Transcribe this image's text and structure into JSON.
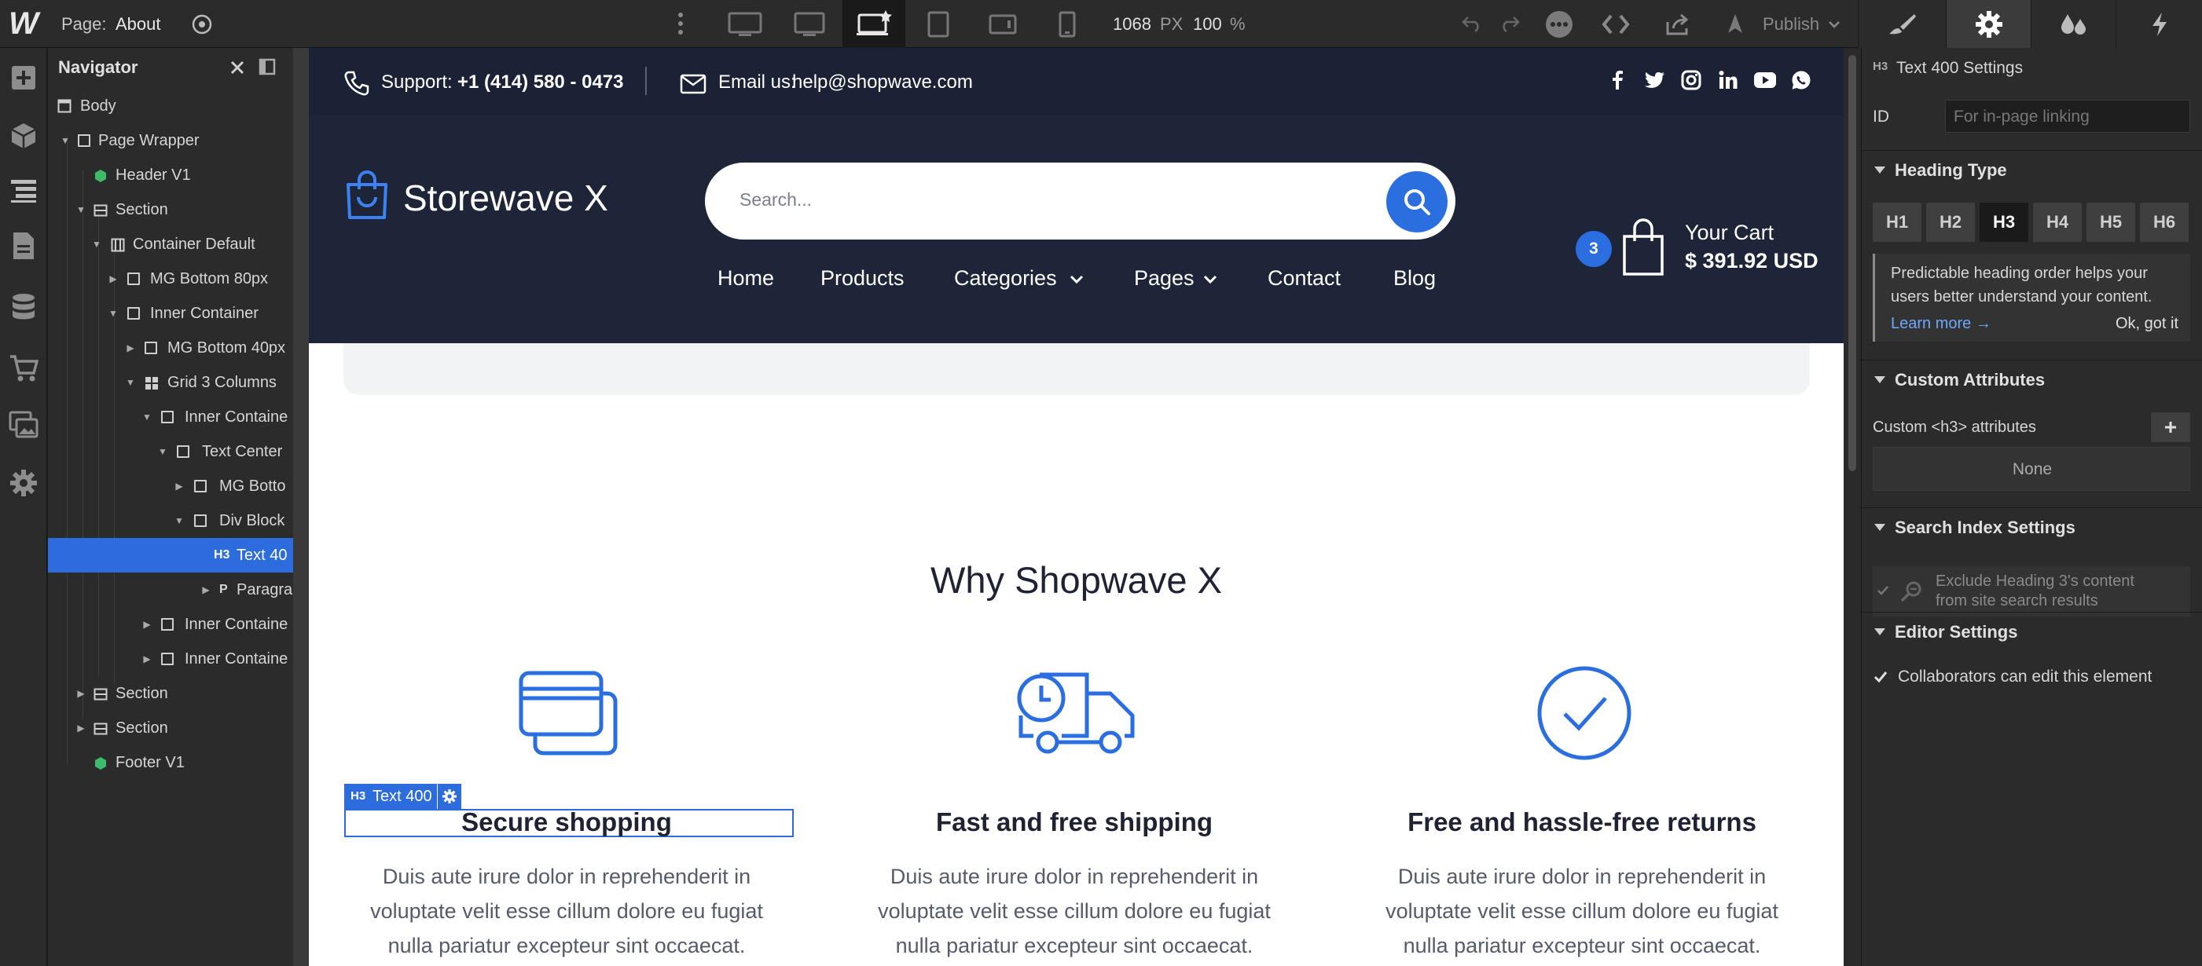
{
  "topbar": {
    "logo": "W",
    "page_label": "Page:",
    "page_name": "About",
    "width_value": "1068",
    "width_unit": "PX",
    "zoom": "100",
    "zoom_unit": "%",
    "publish": "Publish"
  },
  "navigator": {
    "title": "Navigator",
    "items": [
      {
        "label": "Body"
      },
      {
        "label": "Page Wrapper"
      },
      {
        "label": "Header V1"
      },
      {
        "label": "Section"
      },
      {
        "label": "Container Default"
      },
      {
        "label": "MG Bottom 80px"
      },
      {
        "label": "Inner Container"
      },
      {
        "label": "MG Bottom 40px"
      },
      {
        "label": "Grid 3 Columns"
      },
      {
        "label": "Inner Containe"
      },
      {
        "label": "Text Center"
      },
      {
        "label": "MG Botto"
      },
      {
        "label": "Div Block"
      },
      {
        "label": "Text 40",
        "tag": "H3"
      },
      {
        "label": "Paragra",
        "tag": "P"
      },
      {
        "label": "Inner Containe"
      },
      {
        "label": "Inner Containe"
      },
      {
        "label": "Section"
      },
      {
        "label": "Section"
      },
      {
        "label": "Footer V1"
      }
    ]
  },
  "site": {
    "support_label": "Support:",
    "support_phone": "+1 (414) 580 - 0473",
    "email_label": "Email us:",
    "email": "help@shopwave.com",
    "brand": "Storewave X",
    "search_placeholder": "Search...",
    "cart_count": "3",
    "cart_label": "Your Cart",
    "cart_total": "$ 391.92 USD",
    "menu": [
      "Home",
      "Products",
      "Categories",
      "Pages",
      "Contact",
      "Blog"
    ],
    "section_title": "Why  Shopwave X",
    "selection_tag": "H3",
    "selection_label": "Text 400",
    "features": [
      {
        "title": "Secure shopping",
        "icon": "credit-cards-icon",
        "text": "Duis aute irure dolor in reprehenderit in voluptate velit esse cillum dolore eu fugiat nulla pariatur excepteur sint occaecat."
      },
      {
        "title": "Fast and free shipping",
        "icon": "delivery-truck-icon",
        "text": "Duis aute irure dolor in reprehenderit in voluptate velit esse cillum dolore eu fugiat nulla pariatur excepteur sint occaecat."
      },
      {
        "title": "Free and hassle-free returns",
        "icon": "check-circle-icon",
        "text": "Duis aute irure dolor in reprehenderit in voluptate velit esse cillum dolore eu fugiat nulla pariatur excepteur sint occaecat."
      }
    ]
  },
  "panel": {
    "tag": "H3",
    "title": "Text 400 Settings",
    "id_label": "ID",
    "id_placeholder": "For in-page linking",
    "heading_type": "Heading Type",
    "headings": [
      "H1",
      "H2",
      "H3",
      "H4",
      "H5",
      "H6"
    ],
    "heading_selected": "H3",
    "tip": "Predictable heading order helps your users better understand your content.",
    "learn_more": "Learn more →",
    "ok_got_it": "Ok, got it",
    "custom_attributes": "Custom Attributes",
    "custom_attr_label": "Custom <h3> attributes",
    "none": "None",
    "search_index": "Search Index Settings",
    "exclude_text_1": "Exclude Heading 3's content",
    "exclude_text_2": "from site search results",
    "editor_settings": "Editor Settings",
    "collaborators": "Collaborators can edit this element"
  },
  "colors": {
    "accent": "#2c6cdc",
    "site_dark": "#1f2538",
    "site_blue": "#2a6ee0"
  }
}
